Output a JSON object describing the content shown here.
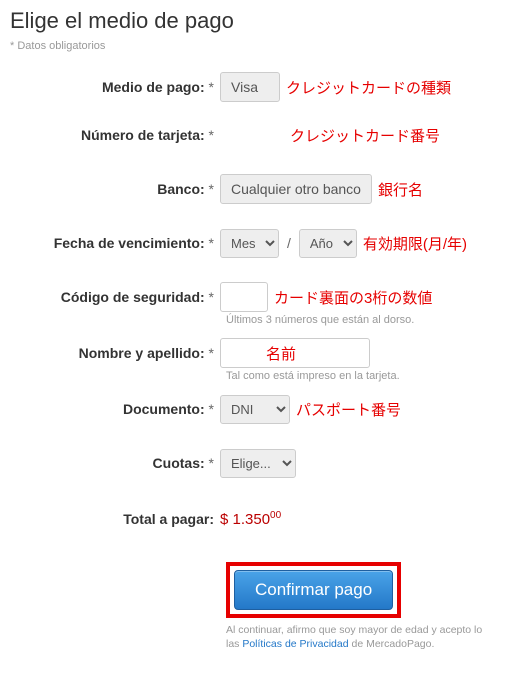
{
  "title": "Elige el medio de pago",
  "required_note": "* Datos obligatorios",
  "labels": {
    "payment_method": "Medio de pago:",
    "card_number": "Número de tarjeta:",
    "bank": "Banco:",
    "expiry": "Fecha de vencimiento:",
    "security_code": "Código de seguridad:",
    "name": "Nombre y apellido:",
    "document": "Documento:",
    "installments": "Cuotas:",
    "total": "Total a pagar:"
  },
  "asterisk": "*",
  "values": {
    "payment_method": "Visa",
    "bank": "Cualquier otro banco",
    "expiry_month": "Mes",
    "expiry_year": "Año",
    "document_type": "DNI",
    "installments": "Elige...",
    "total_int": "$ 1.350",
    "total_dec": "00"
  },
  "hints": {
    "security_code": "Últimos 3 números que están al dorso.",
    "name": "Tal como está impreso en la tarjeta."
  },
  "annotations": {
    "payment_method": "クレジットカードの種類",
    "card_number": "クレジットカード番号",
    "bank": "銀行名",
    "expiry": "有効期限(月/年)",
    "security_code": "カード裏面の3桁の数値",
    "name": "名前",
    "document": "パスポート番号"
  },
  "submit_label": "Confirmar pago",
  "disclaimer_pre": "Al continuar, afirmo que soy mayor de edad y acepto lo",
  "disclaimer_link_prefix": "las ",
  "disclaimer_link": "Políticas de Privacidad",
  "disclaimer_post": " de MercadoPago."
}
